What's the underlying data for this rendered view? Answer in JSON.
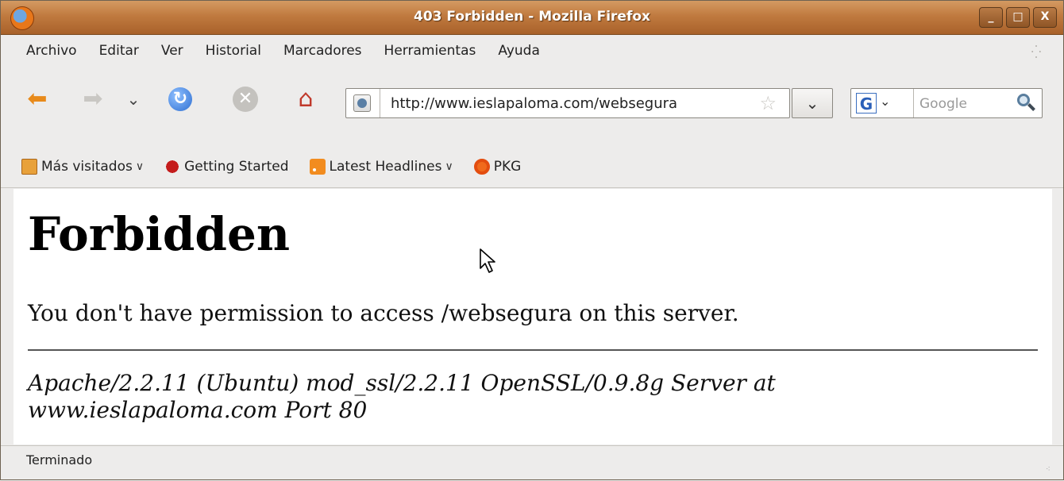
{
  "window": {
    "title": "403 Forbidden - Mozilla Firefox",
    "buttons": [
      "_",
      "□",
      "X"
    ]
  },
  "menu": {
    "items": [
      "Archivo",
      "Editar",
      "Ver",
      "Historial",
      "Marcadores",
      "Herramientas",
      "Ayuda"
    ]
  },
  "nav": {
    "url": "http://www.ieslapaloma.com/websegura",
    "search_placeholder": "Google"
  },
  "bookmarks": {
    "items": [
      "Más visitados",
      "Getting Started",
      "Latest Headlines",
      "PKG"
    ]
  },
  "page": {
    "heading": "Forbidden",
    "message": "You don't have permission to access /websegura on this server.",
    "address": "Apache/2.2.11 (Ubuntu) mod_ssl/2.2.11 OpenSSL/0.9.8g Server at www.ieslapaloma.com Port 80"
  },
  "status": {
    "text": "Terminado"
  },
  "colors": {
    "titlebar": "#c07a3f",
    "chrome": "#edeceb",
    "back_arrow": "#e88a1a",
    "reload": "#2f6fd1"
  }
}
